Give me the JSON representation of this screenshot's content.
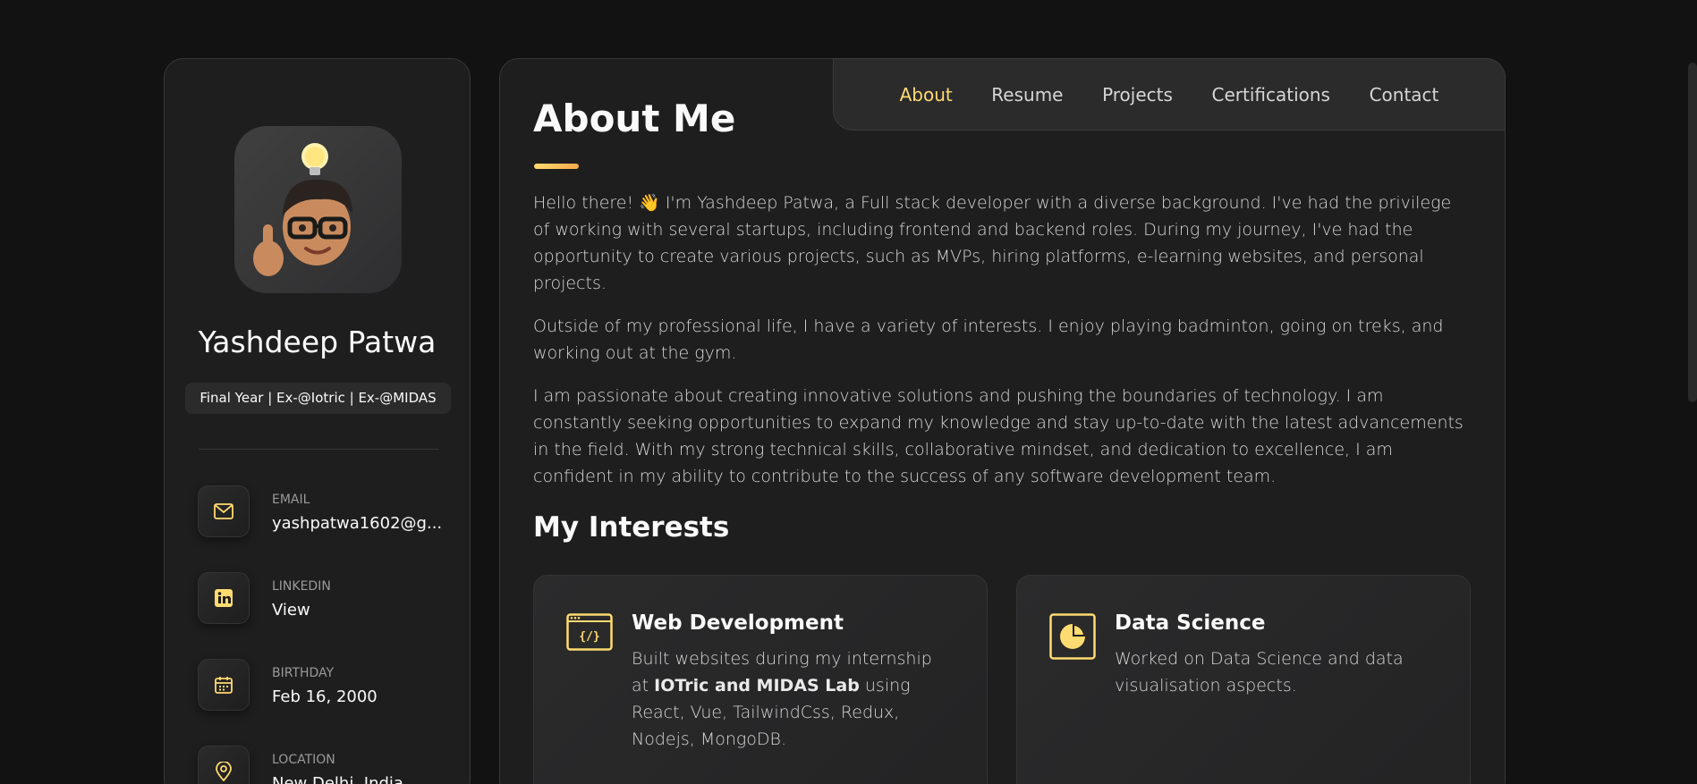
{
  "profile": {
    "name": "Yashdeep Patwa",
    "title": "Final Year | Ex-@Iotric | Ex-@MIDAS",
    "contacts": [
      {
        "label": "EMAIL",
        "value": "yashpatwa1602@g...",
        "icon": "mail-icon"
      },
      {
        "label": "LINKEDIN",
        "value": "View",
        "icon": "linkedin-icon"
      },
      {
        "label": "BIRTHDAY",
        "value": "Feb 16, 2000",
        "icon": "calendar-icon"
      },
      {
        "label": "LOCATION",
        "value": "New Delhi, India",
        "icon": "location-icon"
      }
    ]
  },
  "nav": {
    "items": [
      "About",
      "Resume",
      "Projects",
      "Certifications",
      "Contact"
    ],
    "active": "About"
  },
  "about": {
    "title": "About Me",
    "paragraphs": [
      "Hello there! 👋 I'm Yashdeep Patwa, a Full stack developer with a diverse background. I've had the privilege of working with several startups, including frontend and backend roles. During my journey, I've had the opportunity to create various projects, such as MVPs, hiring platforms, e-learning websites, and personal projects.",
      "Outside of my professional life, I have a variety of interests. I enjoy playing badminton, going on treks, and working out at the gym.",
      "I am passionate about creating innovative solutions and pushing the boundaries of technology. I am constantly seeking opportunities to expand my knowledge and stay up-to-date with the latest advancements in the field. With my strong technical skills, collaborative mindset, and dedication to excellence, I am confident in my ability to contribute to the success of any software development team."
    ]
  },
  "interests": {
    "title": "My Interests",
    "cards": [
      {
        "title": "Web Development",
        "text_before": "Built websites during my internship at ",
        "text_bold": "IOTric and MIDAS Lab",
        "text_after": " using React, Vue, TailwindCss, Redux, Nodejs, MongoDB.",
        "icon": "code-window-icon"
      },
      {
        "title": "Data Science",
        "text_before": "Worked on Data Science and data visualisation aspects.",
        "text_bold": "",
        "text_after": "",
        "icon": "pie-chart-icon"
      }
    ]
  },
  "colors": {
    "accent": "#ffdb70",
    "background": "#121212",
    "panel": "#1e1e1f"
  }
}
